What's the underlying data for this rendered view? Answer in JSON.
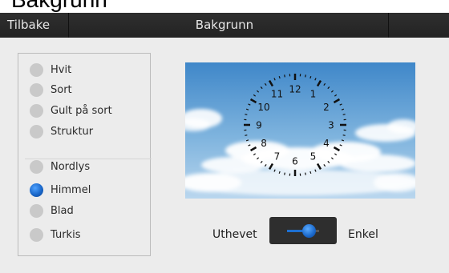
{
  "page_heading": "Bakgrunn",
  "topbar": {
    "back_label": "Tilbake",
    "title": "Bakgrunn"
  },
  "options": [
    {
      "label": "Hvit",
      "selected": false
    },
    {
      "label": "Sort",
      "selected": false
    },
    {
      "label": "Gult på sort",
      "selected": false
    },
    {
      "label": "Struktur",
      "selected": false
    },
    {
      "label": "Nordlys",
      "selected": false
    },
    {
      "label": "Himmel",
      "selected": true
    },
    {
      "label": "Blad",
      "selected": false
    },
    {
      "label": "Turkis",
      "selected": false
    }
  ],
  "preview": {
    "clock_numbers": [
      "12",
      "1",
      "2",
      "3",
      "4",
      "5",
      "6",
      "7",
      "8",
      "9",
      "10",
      "11"
    ]
  },
  "toggle": {
    "left_label": "Uthevet",
    "right_label": "Enkel",
    "value": "Enkel"
  },
  "colors": {
    "accent": "#1a67c9",
    "bar": "#2a2a2a",
    "panel_bg": "#ececec"
  }
}
